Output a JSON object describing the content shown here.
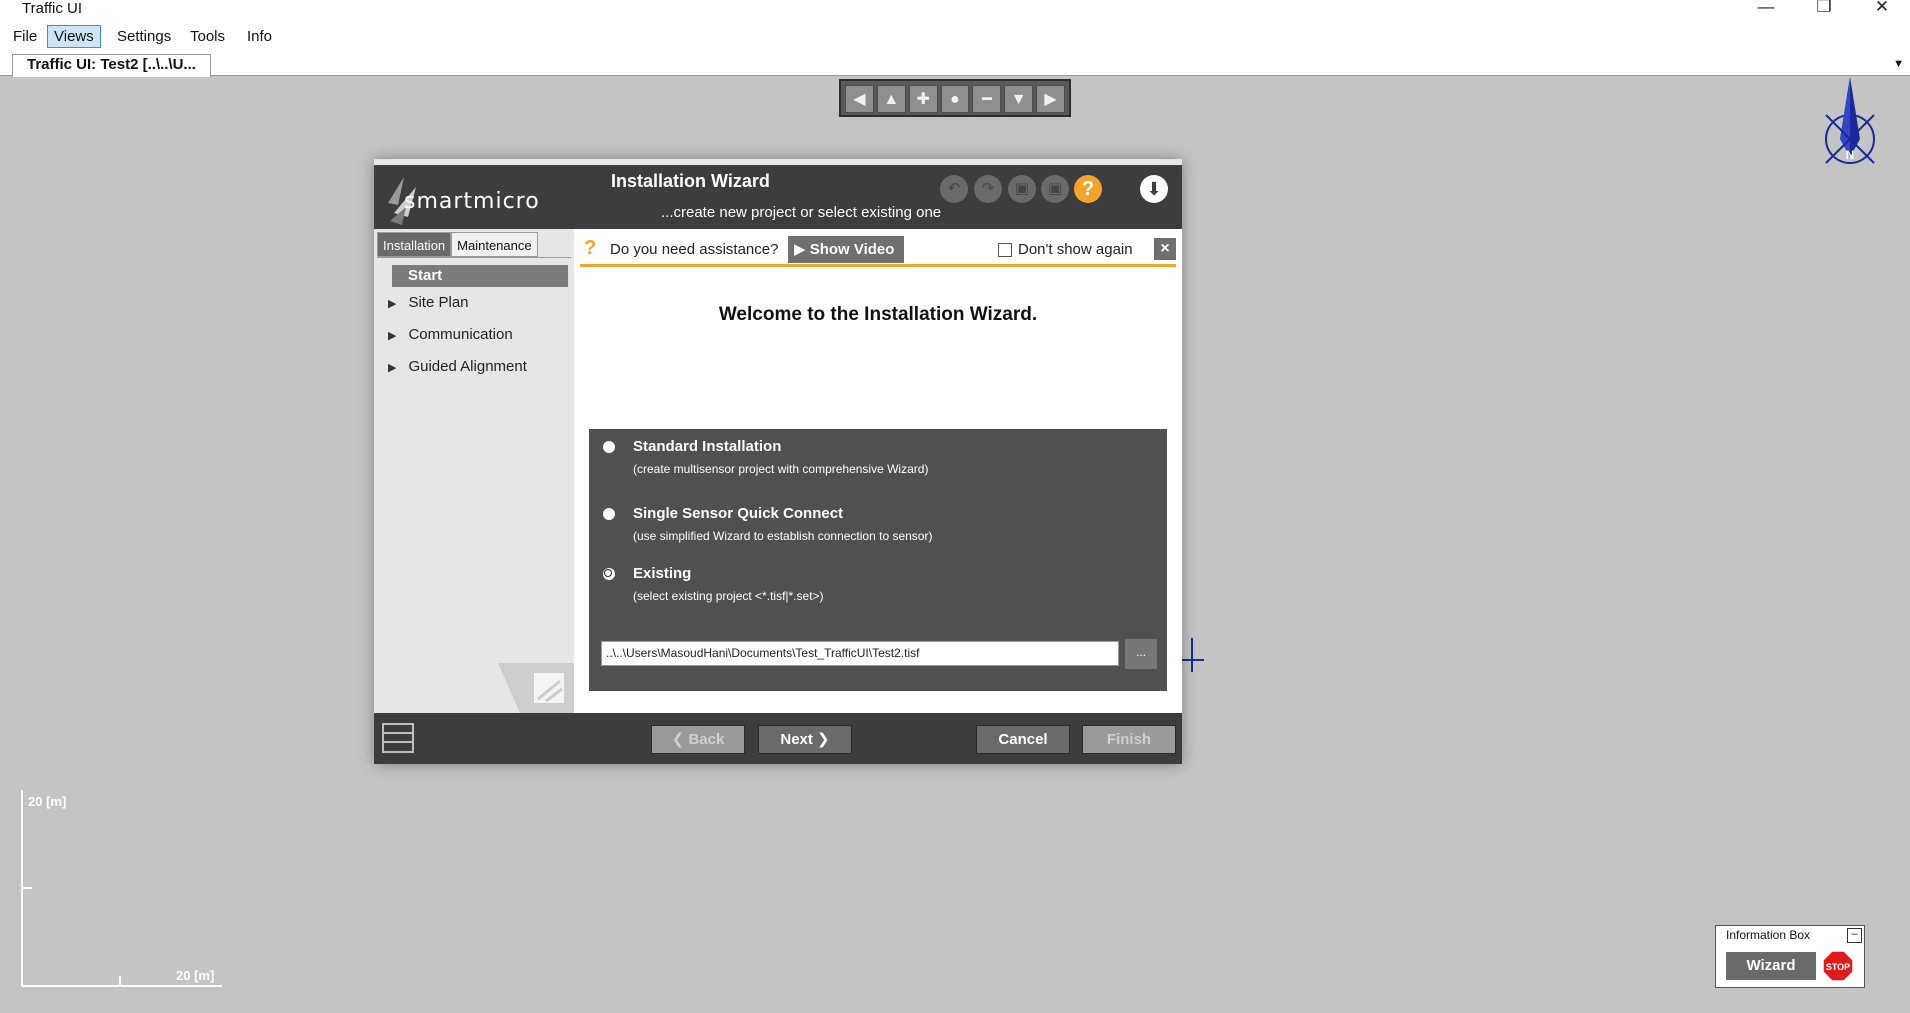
{
  "app": {
    "title": "Traffic UI"
  },
  "window_controls": {
    "minimize": "—",
    "restore": "❐",
    "close": "✕"
  },
  "menu": {
    "items": [
      "File",
      "Views",
      "Settings",
      "Tools",
      "Info"
    ],
    "active": "Views"
  },
  "tab": {
    "label": "Traffic UI: Test2 [..\\..\\U..."
  },
  "nav_toolbar": {
    "icons": [
      "arrow-left-icon",
      "arrow-up-icon",
      "zoom-in-icon",
      "center-icon",
      "zoom-out-icon",
      "arrow-down-icon",
      "arrow-right-icon"
    ],
    "glyphs": [
      "◀",
      "▲",
      "✚",
      "●",
      "━",
      "▼",
      "▶"
    ]
  },
  "compass": {
    "label": "N"
  },
  "scale": {
    "y_label": "20 [m]",
    "x_label": "20 [m]"
  },
  "wizard": {
    "brand": "smartmicro",
    "title": "Installation Wizard",
    "subtitle": "...create new project or select existing one",
    "side_tabs": [
      "Installation",
      "Maintenance"
    ],
    "active_side_tab": "Installation",
    "steps": [
      {
        "label": "Start",
        "active": true
      },
      {
        "label": "Site Plan"
      },
      {
        "label": "Communication"
      },
      {
        "label": "Guided Alignment"
      }
    ],
    "assist": {
      "question": "Do you need assistance?",
      "show_video": "Show Video",
      "dont_show": "Don't show again",
      "close": "×"
    },
    "welcome": "Welcome to the Installation Wizard.",
    "options": [
      {
        "title": "Standard Installation",
        "desc": "(create multisensor project with comprehensive Wizard)",
        "checked": false
      },
      {
        "title": "Single Sensor Quick Connect",
        "desc": "(use simplified Wizard to establish connection to sensor)",
        "checked": false
      },
      {
        "title": "Existing",
        "desc": "(select existing project <*.tisf|*.set>)",
        "checked": true
      }
    ],
    "path_value": "..\\..\\Users\\MasoudHani\\Documents\\Test_TrafficUI\\Test2.tisf",
    "browse_label": "...",
    "footer": {
      "back": "Back",
      "next": "Next",
      "cancel": "Cancel",
      "finish": "Finish"
    }
  },
  "infobox": {
    "title": "Information Box",
    "minimize": "–",
    "wizard": "Wizard",
    "stop": "STOP"
  },
  "colors": {
    "accent": "#f3a42b",
    "header": "#3d3d3f",
    "canvas": "#c4c4c4",
    "options_bg": "#505052"
  }
}
